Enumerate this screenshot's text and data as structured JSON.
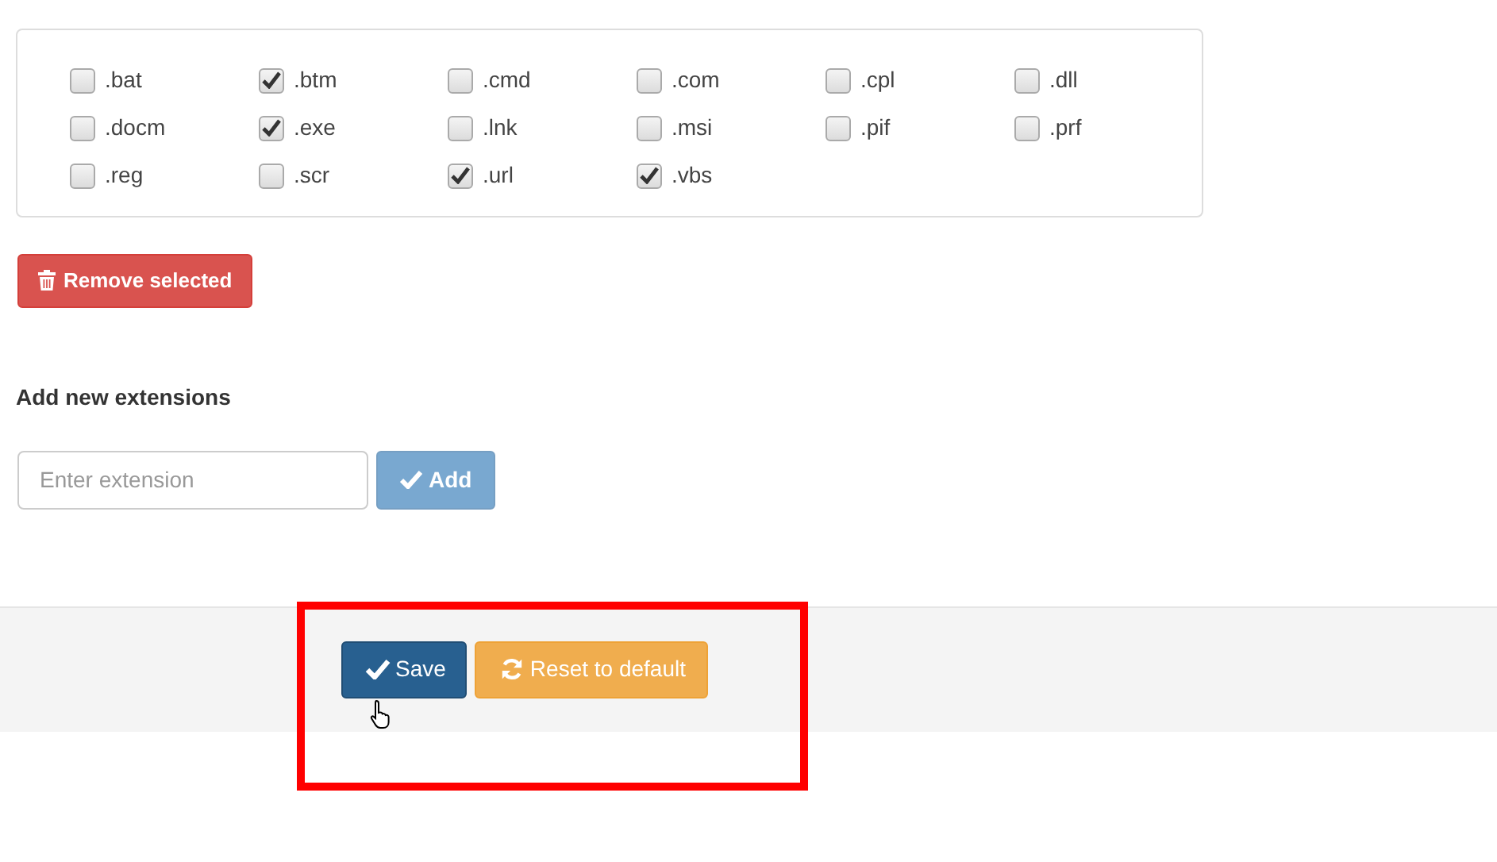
{
  "extensions": [
    {
      "label": ".bat",
      "checked": false
    },
    {
      "label": ".btm",
      "checked": true
    },
    {
      "label": ".cmd",
      "checked": false
    },
    {
      "label": ".com",
      "checked": false
    },
    {
      "label": ".cpl",
      "checked": false
    },
    {
      "label": ".dll",
      "checked": false
    },
    {
      "label": ".docm",
      "checked": false
    },
    {
      "label": ".exe",
      "checked": true
    },
    {
      "label": ".lnk",
      "checked": false
    },
    {
      "label": ".msi",
      "checked": false
    },
    {
      "label": ".pif",
      "checked": false
    },
    {
      "label": ".prf",
      "checked": false
    },
    {
      "label": ".reg",
      "checked": false
    },
    {
      "label": ".scr",
      "checked": false
    },
    {
      "label": ".url",
      "checked": true
    },
    {
      "label": ".vbs",
      "checked": true
    }
  ],
  "remove_button": "Remove selected",
  "add_section": {
    "heading": "Add new extensions",
    "placeholder": "Enter extension",
    "button": "Add",
    "disabled": true
  },
  "footer": {
    "save_button": "Save",
    "reset_button": "Reset to default"
  }
}
